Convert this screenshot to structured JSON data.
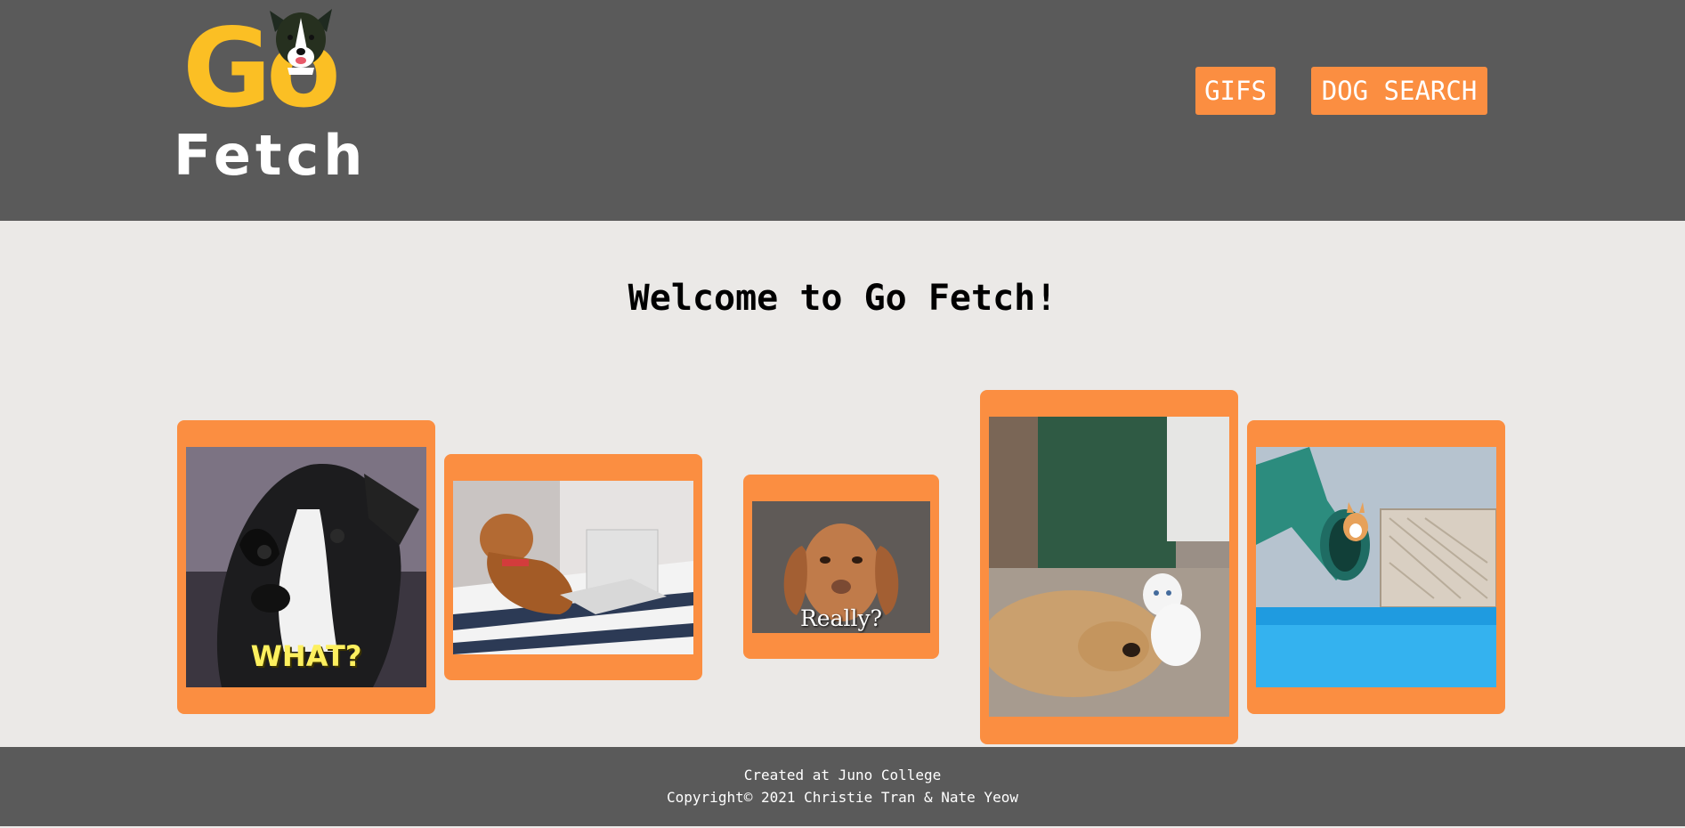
{
  "header": {
    "logo": {
      "line1": "Go",
      "line2": "Fetch"
    },
    "nav": {
      "gifs_label": "GIFS",
      "dog_search_label": "DOG SEARCH"
    }
  },
  "main": {
    "title": "Welcome to Go Fetch!",
    "gifs": [
      {
        "caption": "WHAT?"
      },
      {
        "caption": ""
      },
      {
        "caption": "Really?"
      },
      {
        "caption": ""
      },
      {
        "caption": ""
      }
    ]
  },
  "footer": {
    "line1": "Created at Juno College",
    "line2": "Copyright© 2021 Christie Tran & Nate Yeow"
  },
  "colors": {
    "header_bg": "#5a5a5a",
    "page_bg": "#ebe9e7",
    "accent_orange": "#fb8e41",
    "logo_yellow": "#fbbf24"
  }
}
